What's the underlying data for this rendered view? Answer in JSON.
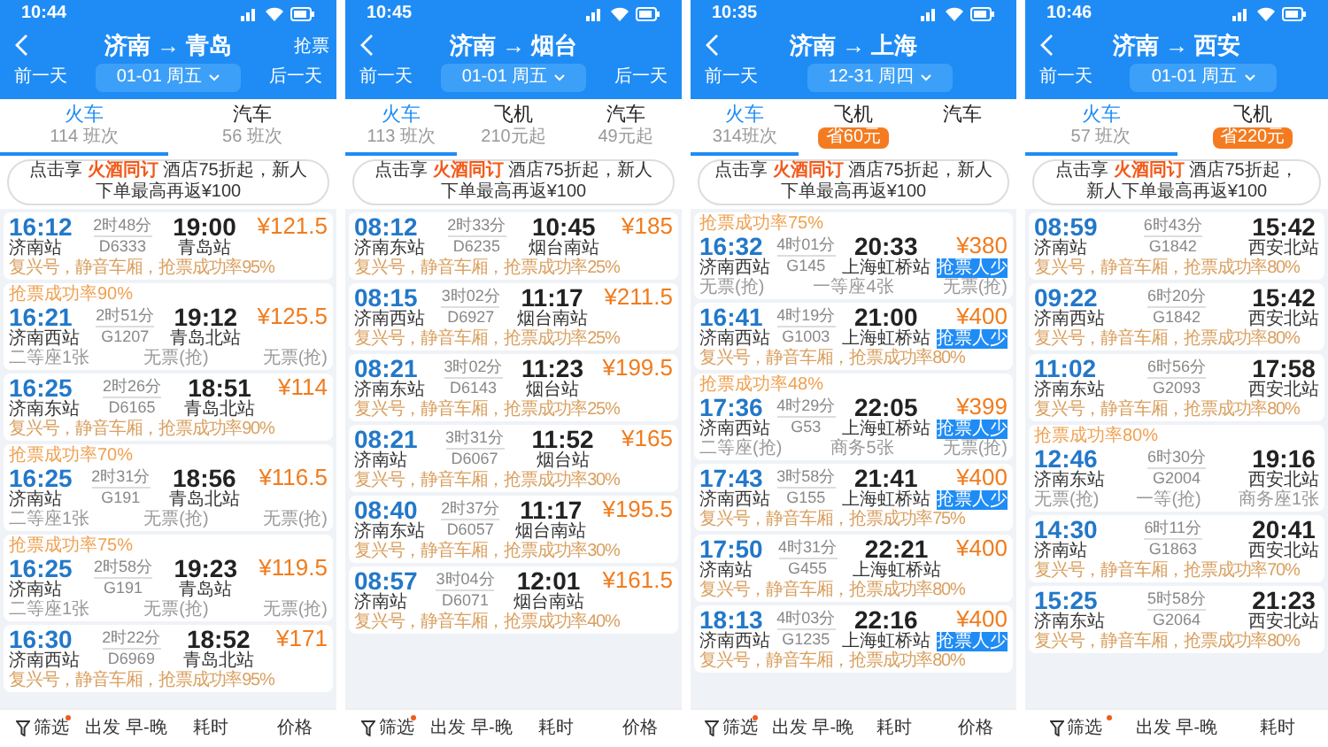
{
  "panels": [
    {
      "status_time": "10:44",
      "title": "济南 → 青岛",
      "action": "抢票",
      "prev": "前一天",
      "date": "01-01 周五",
      "next": "后一天",
      "tabs": [
        {
          "label": "火车",
          "sub": "114 班次",
          "selected": true
        },
        {
          "label": "汽车",
          "sub": "56 班次",
          "selected": false
        }
      ],
      "promo": {
        "lead": "点击享",
        "highlight": "火酒同订",
        "rest": "酒店75折起，新人下单最高再返¥100"
      },
      "trains": [
        {
          "dep": "16:12",
          "dep_station": "济南站",
          "duration": "2时48分",
          "number": "D6333",
          "arr": "19:00",
          "arr_station": "青岛站",
          "price": "¥121.5",
          "note": "复兴号，静音车厢，抢票成功率95%"
        },
        {
          "tag": "抢票成功率90%",
          "dep": "16:21",
          "dep_station": "济南西站",
          "duration": "2时51分",
          "number": "G1207",
          "arr": "19:12",
          "arr_station": "青岛北站",
          "price": "¥125.5",
          "seats": [
            "二等座1张",
            "无票(抢)",
            "无票(抢)"
          ]
        },
        {
          "dep": "16:25",
          "dep_station": "济南东站",
          "duration": "2时26分",
          "number": "D6165",
          "arr": "18:51",
          "arr_station": "青岛北站",
          "price": "¥114",
          "note": "复兴号，静音车厢，抢票成功率90%"
        },
        {
          "tag": "抢票成功率70%",
          "dep": "16:25",
          "dep_station": "济南站",
          "duration": "2时31分",
          "number": "G191",
          "arr": "18:56",
          "arr_station": "青岛北站",
          "price": "¥116.5",
          "seats": [
            "二等座1张",
            "无票(抢)",
            "无票(抢)"
          ]
        },
        {
          "tag": "抢票成功率75%",
          "dep": "16:25",
          "dep_station": "济南站",
          "duration": "2时58分",
          "number": "G191",
          "arr": "19:23",
          "arr_station": "青岛站",
          "price": "¥119.5",
          "seats": [
            "二等座1张",
            "无票(抢)",
            "无票(抢)"
          ]
        },
        {
          "dep": "16:30",
          "dep_station": "济南西站",
          "duration": "2时22分",
          "number": "D6969",
          "arr": "18:52",
          "arr_station": "青岛北站",
          "price": "¥171",
          "note": "复兴号，静音车厢，抢票成功率95%"
        }
      ],
      "bottom": [
        {
          "label": "筛选",
          "kind": "filter",
          "dot": true
        },
        {
          "label": "出发 早-晚",
          "kind": "sort"
        },
        {
          "label": "耗时",
          "kind": "sort"
        },
        {
          "label": "价格",
          "kind": "sort"
        }
      ]
    },
    {
      "status_time": "10:45",
      "title": "济南 → 烟台",
      "prev": "前一天",
      "date": "01-01 周五",
      "next": "后一天",
      "tabs": [
        {
          "label": "火车",
          "sub": "113 班次",
          "selected": true
        },
        {
          "label": "飞机",
          "sub": "210元起",
          "selected": false
        },
        {
          "label": "汽车",
          "sub": "49元起",
          "selected": false
        }
      ],
      "promo": {
        "lead": "点击享",
        "highlight": "火酒同订",
        "rest": "酒店75折起，新人下单最高再返¥100"
      },
      "trains": [
        {
          "dep": "08:12",
          "dep_station": "济南东站",
          "duration": "2时33分",
          "number": "D6235",
          "arr": "10:45",
          "arr_station": "烟台南站",
          "price": "¥185",
          "note": "复兴号，静音车厢，抢票成功率25%"
        },
        {
          "dep": "08:15",
          "dep_station": "济南西站",
          "duration": "3时02分",
          "number": "D6927",
          "arr": "11:17",
          "arr_station": "烟台南站",
          "price": "¥211.5",
          "note": "复兴号，静音车厢，抢票成功率25%"
        },
        {
          "dep": "08:21",
          "dep_station": "济南东站",
          "duration": "3时02分",
          "number": "D6143",
          "arr": "11:23",
          "arr_station": "烟台站",
          "price": "¥199.5",
          "note": "复兴号，静音车厢，抢票成功率25%"
        },
        {
          "dep": "08:21",
          "dep_station": "济南站",
          "duration": "3时31分",
          "number": "D6067",
          "arr": "11:52",
          "arr_station": "烟台站",
          "price": "¥165",
          "note": "复兴号，静音车厢，抢票成功率30%"
        },
        {
          "dep": "08:40",
          "dep_station": "济南东站",
          "duration": "2时37分",
          "number": "D6057",
          "arr": "11:17",
          "arr_station": "烟台南站",
          "price": "¥195.5",
          "note": "复兴号，静音车厢，抢票成功率30%"
        },
        {
          "dep": "08:57",
          "dep_station": "济南站",
          "duration": "3时04分",
          "number": "D6071",
          "arr": "12:01",
          "arr_station": "烟台南站",
          "price": "¥161.5",
          "note": "复兴号，静音车厢，抢票成功率40%"
        }
      ],
      "bottom": [
        {
          "label": "筛选",
          "kind": "filter",
          "dot": true
        },
        {
          "label": "出发 早-晚",
          "kind": "sort"
        },
        {
          "label": "耗时",
          "kind": "sort"
        },
        {
          "label": "价格",
          "kind": "sort"
        }
      ]
    },
    {
      "status_time": "10:35",
      "title": "济南 → 上海",
      "prev": "前一天",
      "date": "12-31 周四",
      "tabs": [
        {
          "label": "火车",
          "sub": "314班次",
          "selected": true
        },
        {
          "label": "飞机",
          "badge": "省60元",
          "selected": false
        },
        {
          "label": "汽车",
          "selected": false
        }
      ],
      "promo": {
        "lead": "点击享",
        "highlight": "火酒同订",
        "rest": "酒店75折起，新人下单最高再返¥100"
      },
      "trains": [
        {
          "tag": "抢票成功率75%",
          "dep": "16:32",
          "dep_station": "济南西站",
          "duration": "4时01分",
          "number": "G145",
          "arr": "20:33",
          "arr_station": "上海虹桥站",
          "price": "¥380",
          "button": "抢票人少",
          "seats": [
            "无票(抢)",
            "一等座4张",
            "无票(抢)"
          ]
        },
        {
          "dep": "16:41",
          "dep_station": "济南西站",
          "duration": "4时19分",
          "number": "G1003",
          "arr": "21:00",
          "arr_station": "上海虹桥站",
          "price": "¥400",
          "button": "抢票人少",
          "note": "复兴号，静音车厢，抢票成功率80%"
        },
        {
          "tag": "抢票成功率48%",
          "dep": "17:36",
          "dep_station": "济南西站",
          "duration": "4时29分",
          "number": "G53",
          "arr": "22:05",
          "arr_station": "上海虹桥站",
          "price": "¥399",
          "button": "抢票人少",
          "seats": [
            "二等座(抢)",
            "商务5张",
            "无票(抢)"
          ]
        },
        {
          "dep": "17:43",
          "dep_station": "济南西站",
          "duration": "3时58分",
          "number": "G155",
          "arr": "21:41",
          "arr_station": "上海虹桥站",
          "price": "¥400",
          "button": "抢票人少",
          "note": "复兴号，静音车厢，抢票成功率75%"
        },
        {
          "dep": "17:50",
          "dep_station": "济南站",
          "duration": "4时31分",
          "number": "G455",
          "arr": "22:21",
          "arr_station": "上海虹桥站",
          "price": "¥400",
          "note": "复兴号，静音车厢，抢票成功率80%"
        },
        {
          "dep": "18:13",
          "dep_station": "济南西站",
          "duration": "4时03分",
          "number": "G1235",
          "arr": "22:16",
          "arr_station": "上海虹桥站",
          "price": "¥400",
          "button": "抢票人少",
          "note": "复兴号，静音车厢，抢票成功率80%"
        }
      ],
      "bottom": [
        {
          "label": "筛选",
          "kind": "filter",
          "dot": true
        },
        {
          "label": "出发 早-晚",
          "kind": "sort"
        },
        {
          "label": "耗时",
          "kind": "sort"
        },
        {
          "label": "价格",
          "kind": "sort"
        }
      ]
    },
    {
      "status_time": "10:46",
      "title": "济南 → 西安",
      "prev": "前一天",
      "date": "01-01 周五",
      "tabs": [
        {
          "label": "火车",
          "sub": "57 班次",
          "selected": true
        },
        {
          "label": "飞机",
          "badge": "省220元",
          "selected": false
        }
      ],
      "promo": {
        "lead": "点击享",
        "highlight": "火酒同订",
        "rest": "酒店75折起，新人下单最高再返¥100"
      },
      "trains": [
        {
          "dep": "08:59",
          "dep_station": "济南站",
          "duration": "6时43分",
          "number": "G1842",
          "arr": "15:42",
          "arr_station": "西安北站",
          "note": "复兴号，静音车厢，抢票成功率80%"
        },
        {
          "dep": "09:22",
          "dep_station": "济南西站",
          "duration": "6时20分",
          "number": "G1842",
          "arr": "15:42",
          "arr_station": "西安北站",
          "note": "复兴号，静音车厢，抢票成功率80%"
        },
        {
          "dep": "11:02",
          "dep_station": "济南东站",
          "duration": "6时56分",
          "number": "G2093",
          "arr": "17:58",
          "arr_station": "西安北站",
          "note": "复兴号，静音车厢，抢票成功率80%"
        },
        {
          "tag": "抢票成功率80%",
          "dep": "12:46",
          "dep_station": "济南东站",
          "duration": "6时30分",
          "number": "G2004",
          "arr": "19:16",
          "arr_station": "西安北站",
          "seats": [
            "无票(抢)",
            "一等(抢)",
            "商务座1张"
          ]
        },
        {
          "dep": "14:30",
          "dep_station": "济南站",
          "duration": "6时11分",
          "number": "G1863",
          "arr": "20:41",
          "arr_station": "西安北站",
          "note": "复兴号，静音车厢，抢票成功率70%"
        },
        {
          "dep": "15:25",
          "dep_station": "济南东站",
          "duration": "5时58分",
          "number": "G2064",
          "arr": "21:23",
          "arr_station": "西安北站",
          "note": "复兴号，静音车厢，抢票成功率80%"
        }
      ],
      "bottom": [
        {
          "label": "筛选",
          "kind": "filter",
          "dot": true
        },
        {
          "label": "出发 早-晚",
          "kind": "sort"
        },
        {
          "label": "耗时",
          "kind": "sort"
        }
      ]
    }
  ]
}
